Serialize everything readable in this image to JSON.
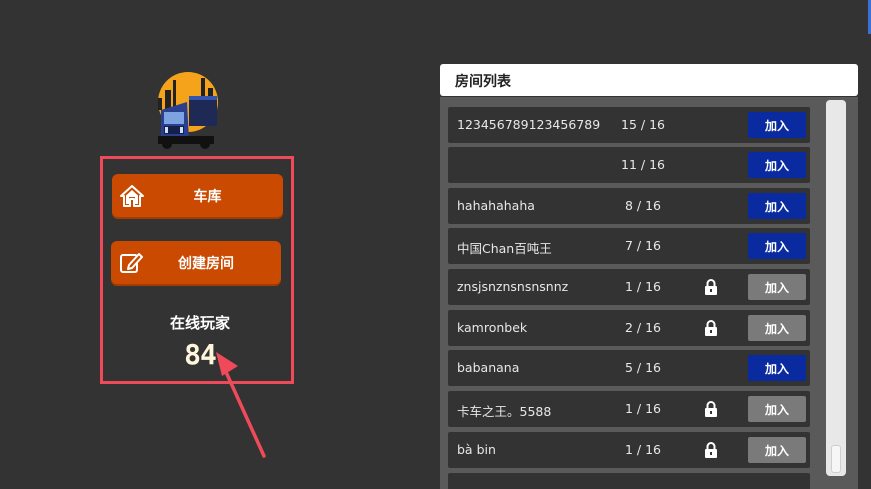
{
  "sidebar": {
    "garage_label": "车库",
    "create_room_label": "创建房间",
    "online_label": "在线玩家",
    "online_count": "84"
  },
  "room_list": {
    "title": "房间列表",
    "rooms": [
      {
        "name": "123456789123456789",
        "count": "15 / 16",
        "locked": false,
        "join_label": "加入"
      },
      {
        "name": "",
        "count": "11 / 16",
        "locked": false,
        "join_label": "加入"
      },
      {
        "name": "hahahahaha",
        "count": "8 / 16",
        "locked": false,
        "join_label": "加入"
      },
      {
        "name": "中国Chan百吨王",
        "count": "7 / 16",
        "locked": false,
        "join_label": "加入"
      },
      {
        "name": "znsjsnznsnsnsnnz",
        "count": "1 / 16",
        "locked": true,
        "join_label": "加入"
      },
      {
        "name": "kamronbek",
        "count": "2 / 16",
        "locked": true,
        "join_label": "加入"
      },
      {
        "name": "babanana",
        "count": "5 / 16",
        "locked": false,
        "join_label": "加入"
      },
      {
        "name": "卡车之王。5588",
        "count": "1 / 16",
        "locked": true,
        "join_label": "加入"
      },
      {
        "name": "bà bin",
        "count": "1 / 16",
        "locked": true,
        "join_label": "加入"
      }
    ]
  },
  "colors": {
    "background": "#333333",
    "orange_button": "#c94a00",
    "join_open": "#0a2aa0",
    "join_locked": "#7a7a7a",
    "highlight": "#ef4a5a"
  },
  "icons": {
    "garage": "house-icon",
    "create_room": "edit-icon",
    "lock": "lock-icon",
    "logo": "truck-logo"
  }
}
